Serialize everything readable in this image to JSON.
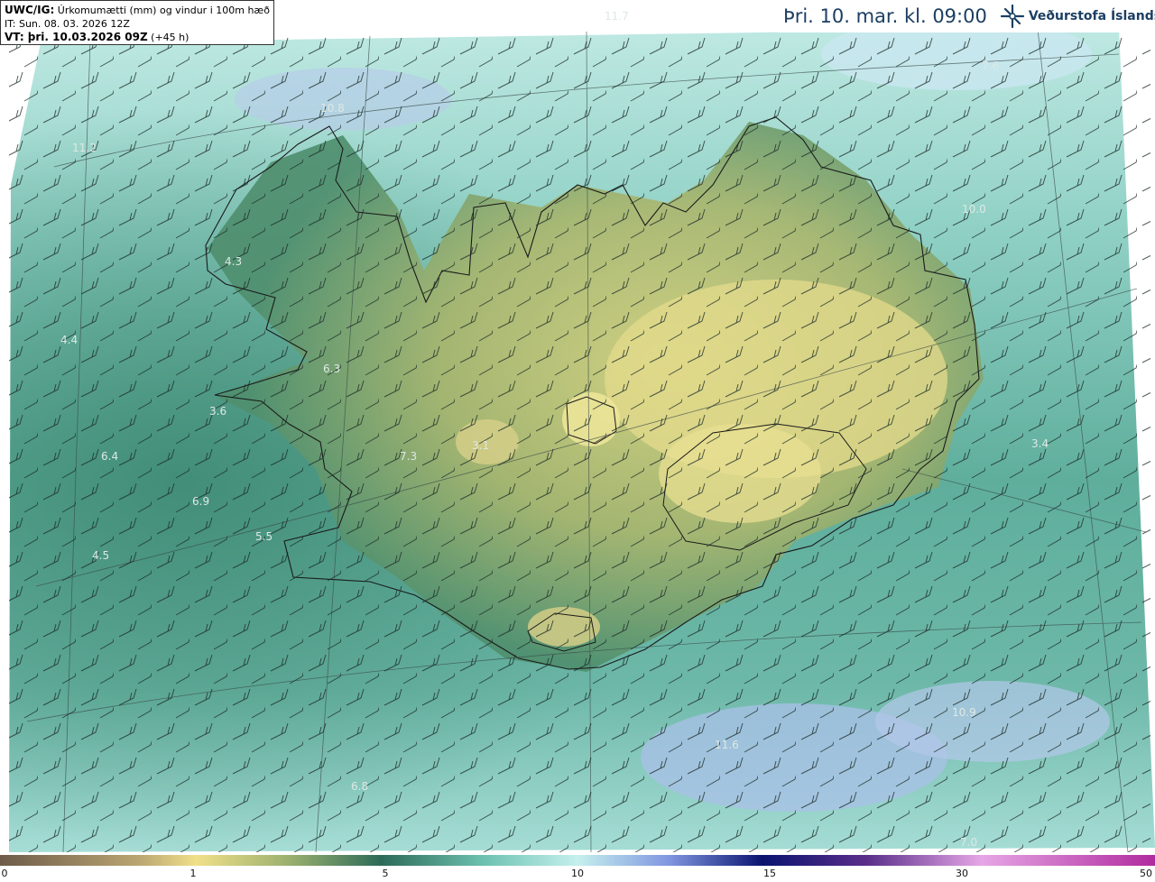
{
  "info": {
    "line1_key": "UWC/IG:",
    "line1_text": "Úrkomumætti (mm) og vindur i 100m hæð",
    "line2": "IT: Sun. 08. 03. 2026 12Z",
    "line3_key": "VT: þri. 10.03.2026 09Z",
    "line3_text": "(+45 h)"
  },
  "header": {
    "title": "Þri. 10. mar. kl. 09:00",
    "logo_text": "Veðurstofa Íslands",
    "logo_icon": "snowflake-cross-icon"
  },
  "map_labels": [
    "11.7",
    "7.6",
    "10.0",
    "10.8",
    "11.2",
    "4.3",
    "4.4",
    "3.6",
    "6.4",
    "6.9",
    "5.5",
    "4.5",
    "7.3",
    "3.1",
    "6.3",
    "3.4",
    "11.6",
    "6.8",
    "7.0",
    "10.9"
  ],
  "colorbar": {
    "ticks": [
      "0",
      "1",
      "5",
      "10",
      "15",
      "30",
      "50"
    ],
    "colors": [
      "#7a5e48",
      "#c9b56e",
      "#f0e28c",
      "#2e6b57",
      "#6fc8b8",
      "#b8ecec",
      "#5a72d0",
      "#0c1a7a",
      "#6b3a9a",
      "#e0a0e0",
      "#b030a0"
    ]
  }
}
